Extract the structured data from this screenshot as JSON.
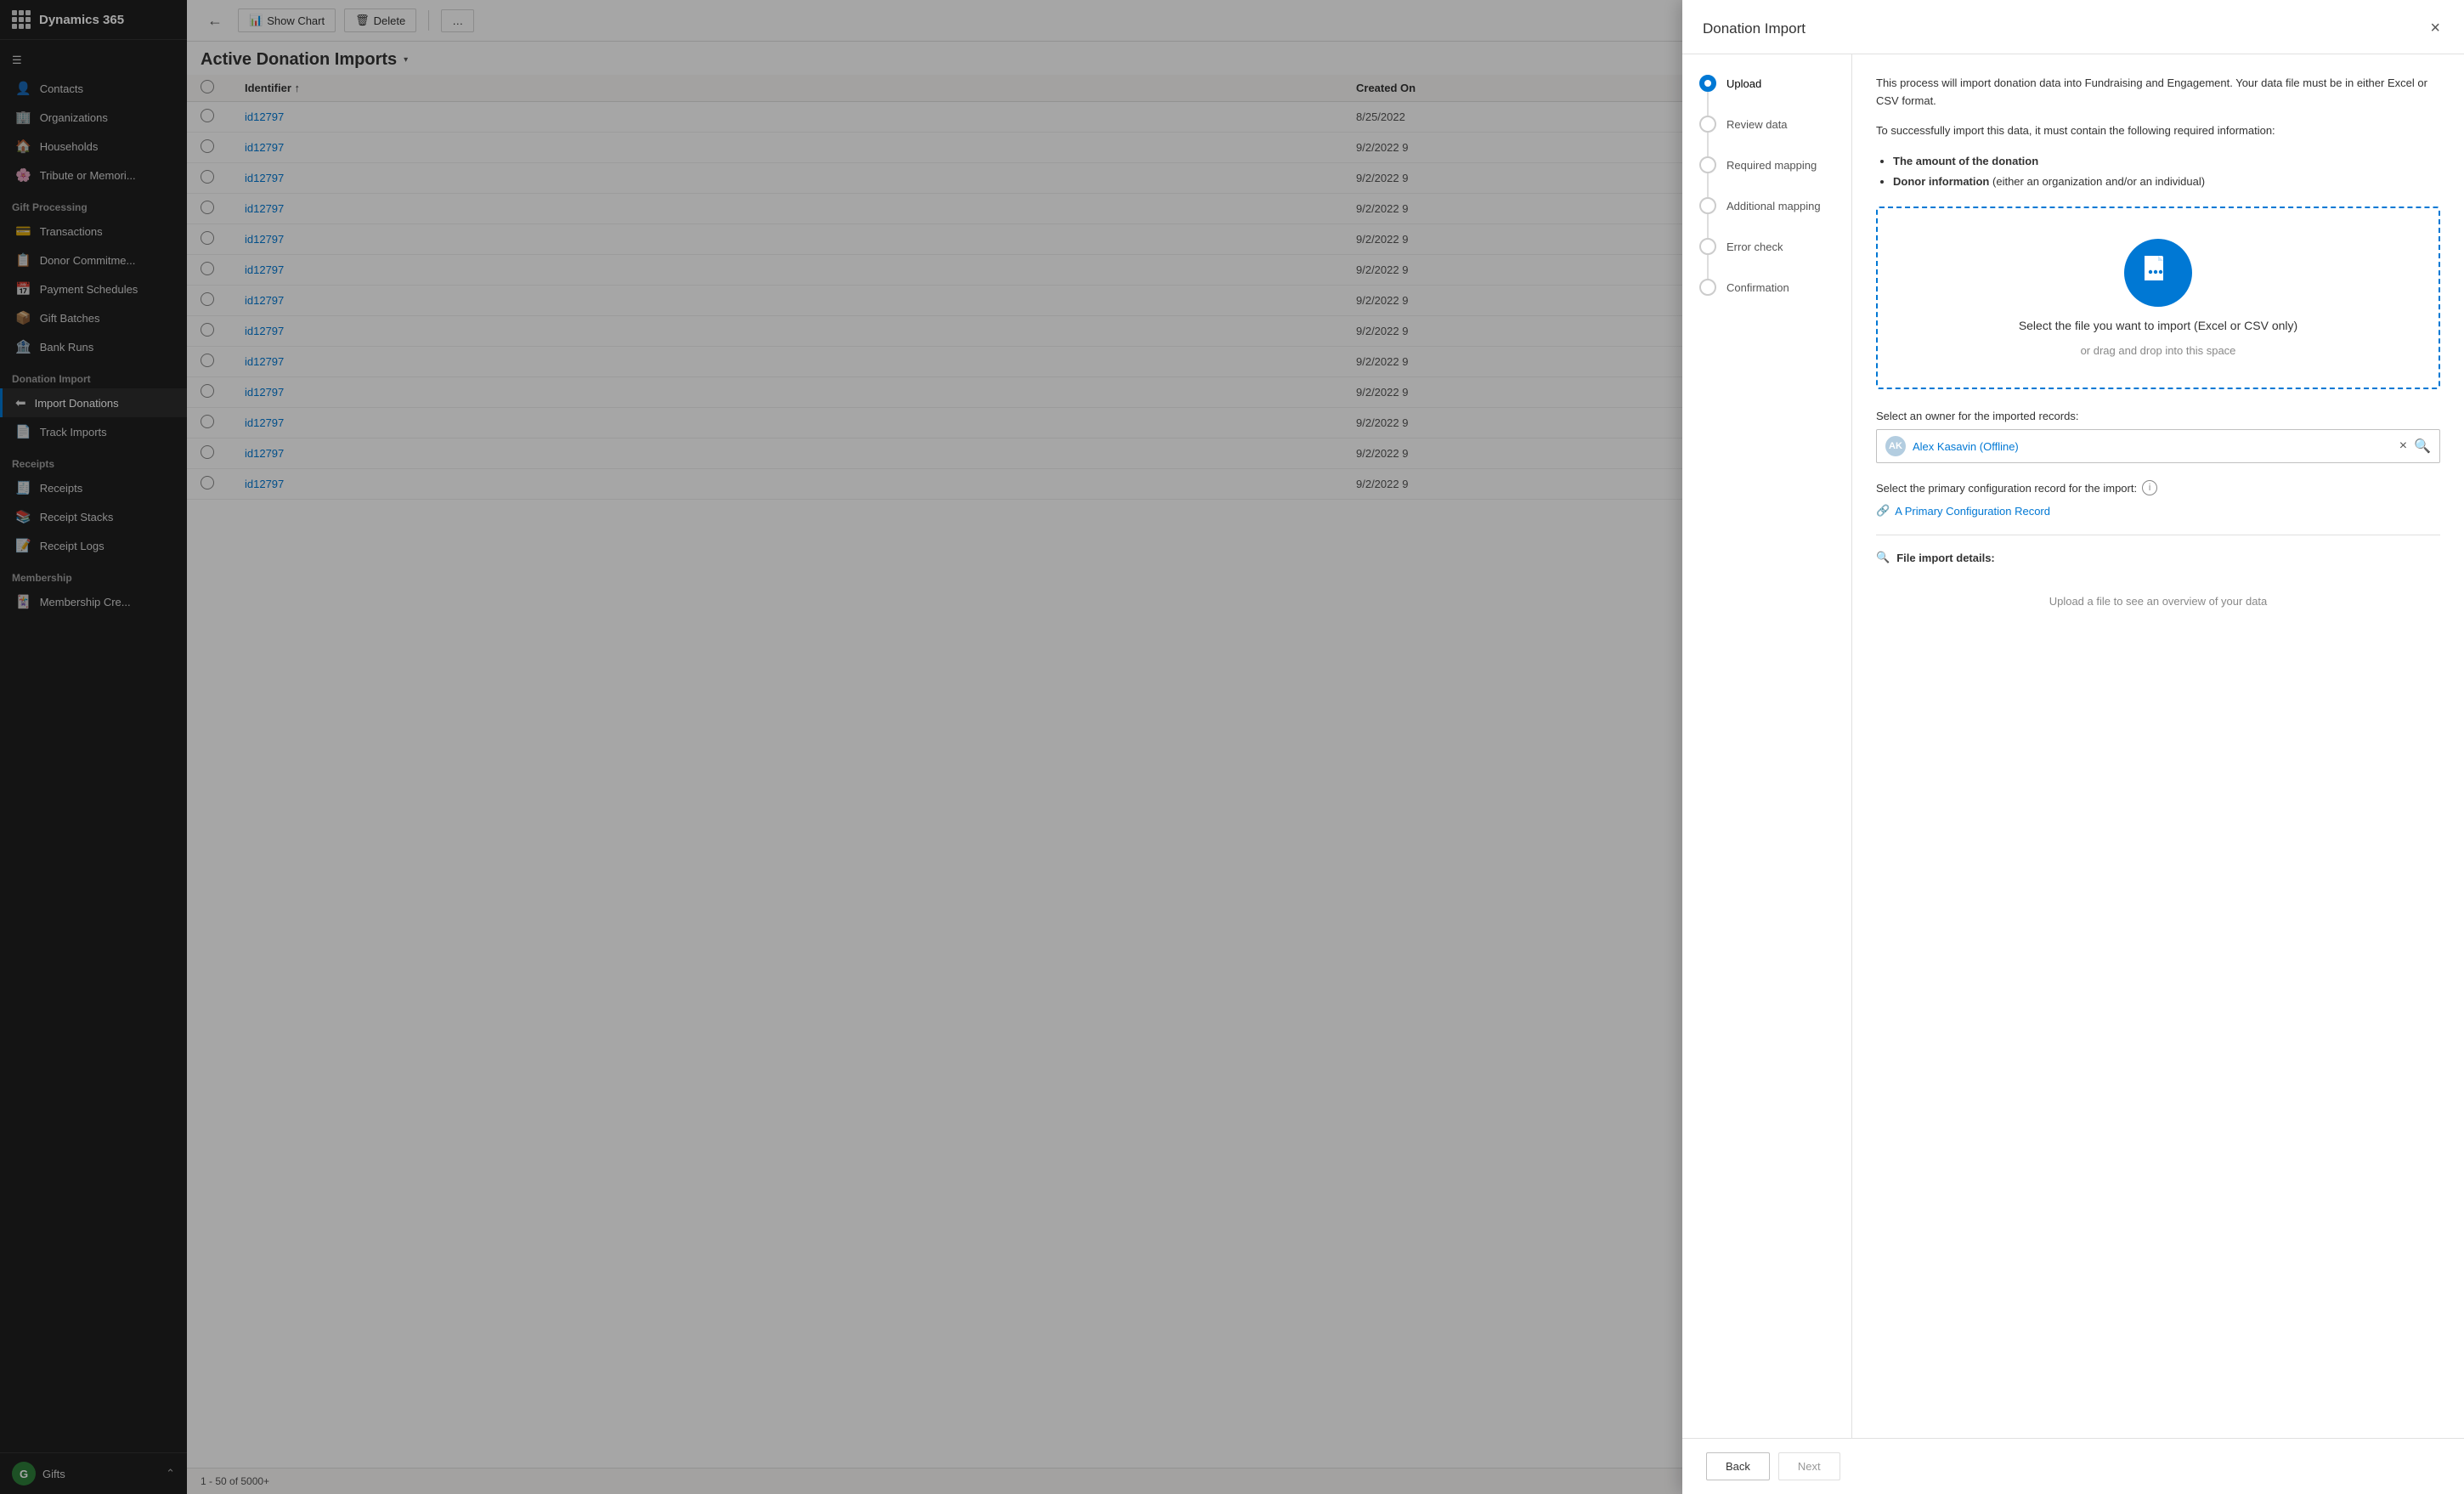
{
  "app": {
    "name": "Dynamics 365",
    "module": "Fundraising and Engagement"
  },
  "sidebar": {
    "sections": [
      {
        "items": [
          {
            "id": "contacts",
            "label": "Contacts",
            "icon": "👤"
          },
          {
            "id": "organizations",
            "label": "Organizations",
            "icon": "🏢"
          },
          {
            "id": "households",
            "label": "Households",
            "icon": "🏠"
          },
          {
            "id": "tribute",
            "label": "Tribute or Memori...",
            "icon": "🌸"
          }
        ]
      },
      {
        "title": "Gift Processing",
        "items": [
          {
            "id": "transactions",
            "label": "Transactions",
            "icon": "💳"
          },
          {
            "id": "donor-commitments",
            "label": "Donor Commitme...",
            "icon": "📋"
          },
          {
            "id": "payment-schedules",
            "label": "Payment Schedules",
            "icon": "📅"
          },
          {
            "id": "gift-batches",
            "label": "Gift Batches",
            "icon": "📦"
          },
          {
            "id": "bank-runs",
            "label": "Bank Runs",
            "icon": "🏦"
          }
        ]
      },
      {
        "title": "Donation Import",
        "items": [
          {
            "id": "import-donations",
            "label": "Import Donations",
            "icon": "⬅",
            "active": true
          },
          {
            "id": "track-imports",
            "label": "Track Imports",
            "icon": "📄"
          }
        ]
      },
      {
        "title": "Receipts",
        "items": [
          {
            "id": "receipts",
            "label": "Receipts",
            "icon": "🧾"
          },
          {
            "id": "receipt-stacks",
            "label": "Receipt Stacks",
            "icon": "📚"
          },
          {
            "id": "receipt-logs",
            "label": "Receipt Logs",
            "icon": "📝"
          }
        ]
      },
      {
        "title": "Membership",
        "items": [
          {
            "id": "membership-cre",
            "label": "Membership Cre...",
            "icon": "🃏"
          }
        ]
      }
    ],
    "footer": {
      "avatar": "G",
      "label": "Gifts"
    }
  },
  "topbar": {
    "back_label": "←",
    "show_chart_label": "Show Chart",
    "delete_label": "Delete",
    "more_label": "…"
  },
  "page": {
    "title": "Active Donation Imports",
    "record_count": "1 - 50 of 5000+"
  },
  "table": {
    "columns": [
      "Identifier ↑",
      "Created On"
    ],
    "rows": [
      {
        "id": "id12797",
        "date": "8/25/2022"
      },
      {
        "id": "id12797",
        "date": "9/2/2022 9"
      },
      {
        "id": "id12797",
        "date": "9/2/2022 9"
      },
      {
        "id": "id12797",
        "date": "9/2/2022 9"
      },
      {
        "id": "id12797",
        "date": "9/2/2022 9"
      },
      {
        "id": "id12797",
        "date": "9/2/2022 9"
      },
      {
        "id": "id12797",
        "date": "9/2/2022 9"
      },
      {
        "id": "id12797",
        "date": "9/2/2022 9"
      },
      {
        "id": "id12797",
        "date": "9/2/2022 9"
      },
      {
        "id": "id12797",
        "date": "9/2/2022 9"
      },
      {
        "id": "id12797",
        "date": "9/2/2022 9"
      },
      {
        "id": "id12797",
        "date": "9/2/2022 9"
      },
      {
        "id": "id12797",
        "date": "9/2/2022 9"
      }
    ]
  },
  "modal": {
    "title": "Donation Import",
    "close_label": "×",
    "steps": [
      {
        "id": "upload",
        "label": "Upload",
        "active": true
      },
      {
        "id": "review",
        "label": "Review data"
      },
      {
        "id": "required",
        "label": "Required mapping"
      },
      {
        "id": "additional",
        "label": "Additional mapping"
      },
      {
        "id": "error",
        "label": "Error check"
      },
      {
        "id": "confirmation",
        "label": "Confirmation"
      }
    ],
    "intro": {
      "line1": "This process will import donation data into Fundraising and Engagement. Your data file must be in either Excel or CSV format.",
      "line2": "To successfully import this data, it must contain the following required information:",
      "required_items": [
        "The amount of the donation",
        "Donor information (either an organization and/or an individual)"
      ]
    },
    "dropzone": {
      "main_text": "Select the file you want to import (Excel or CSV only)",
      "sub_text": "or drag and drop into this space"
    },
    "owner_section": {
      "label": "Select an owner for the imported records:",
      "owner_name": "Alex Kasavin (Offline)",
      "owner_initials": "AK"
    },
    "config_section": {
      "label": "Select the primary configuration record for the import:",
      "link_text": "A Primary Configuration Record"
    },
    "file_details": {
      "header": "File import details:",
      "empty_message": "Upload a file to see an overview of your data"
    },
    "buttons": {
      "back": "Back",
      "next": "Next"
    }
  }
}
